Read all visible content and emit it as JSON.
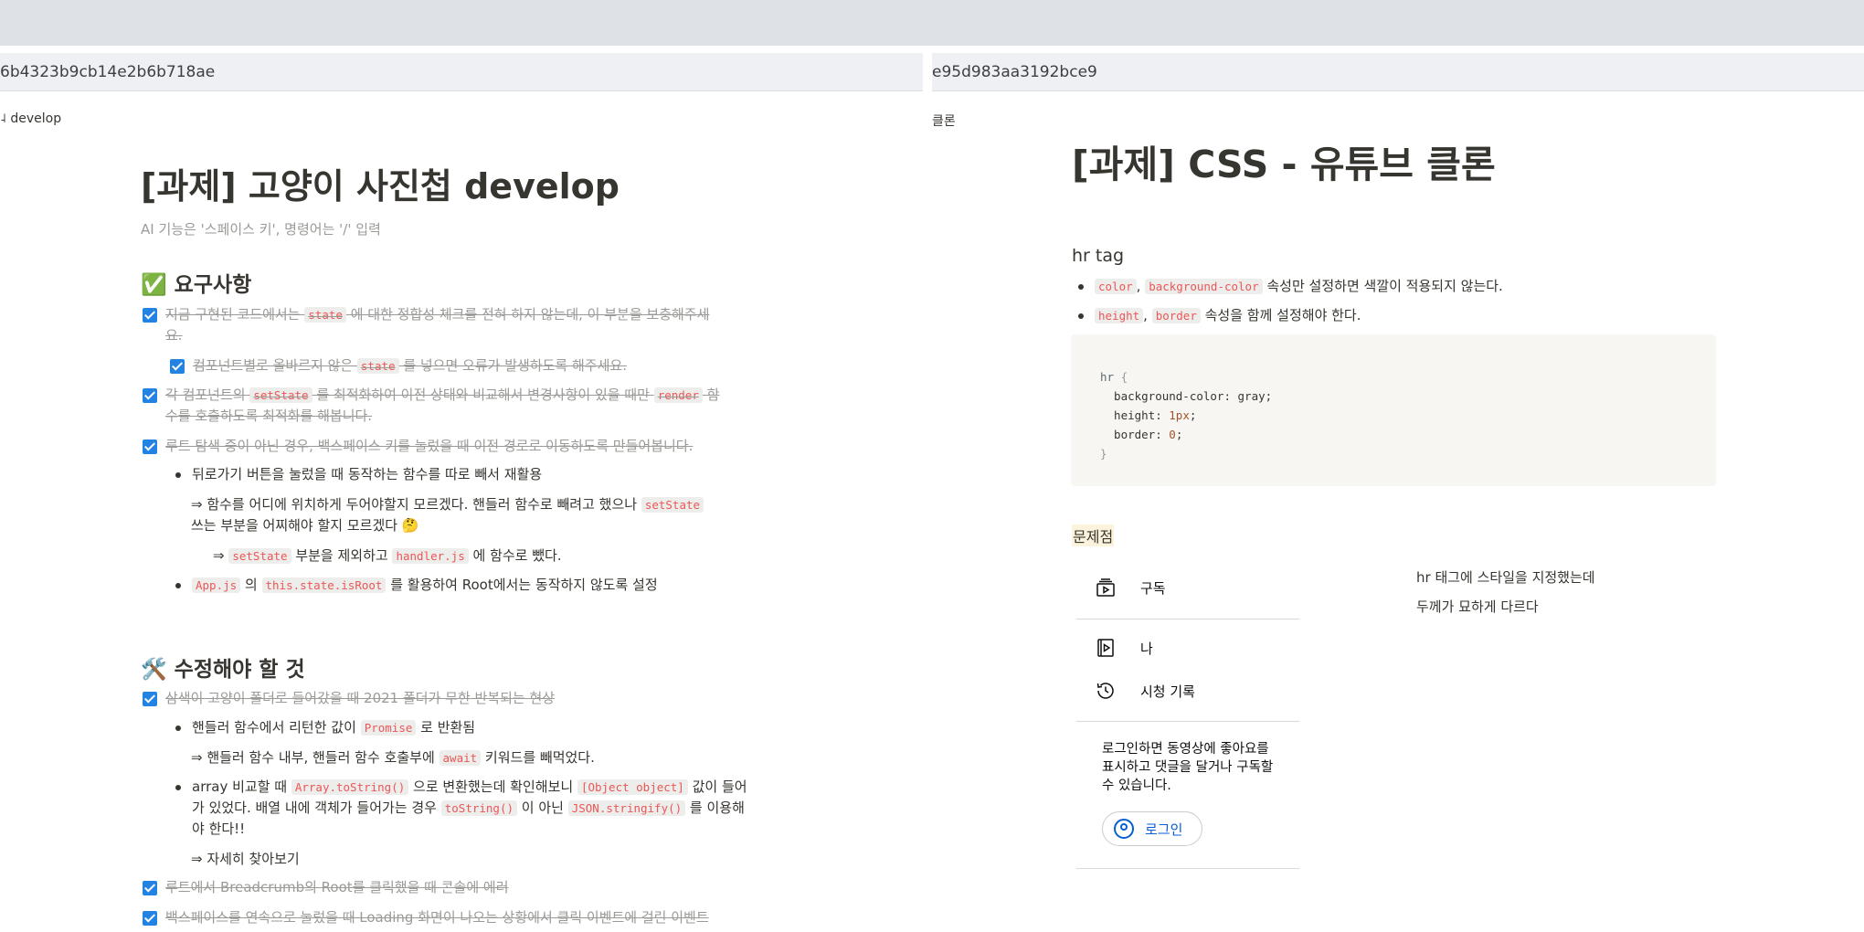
{
  "browser": {
    "left_url": "6b4323b9cb14e2b6b718ae",
    "right_url": "e95d983aa3192bce9",
    "left_breadcrumb": "˨ develop",
    "right_breadcrumb": "클론"
  },
  "left_page": {
    "title": "[과제] 고양이 사진첩 develop",
    "ai_placeholder": "AI 기능은 '스페이스 키', 명령어는 '/' 입력",
    "section1": {
      "emoji": "✅",
      "heading": "요구사항"
    },
    "todos": [
      {
        "t1": "지금 구현된 코드에서는 ",
        "c1": "state",
        "t2": " 에 대한 정합성 체크를 전혀 하지 않는데, 이 부분을 보충해주세",
        "t3": "요."
      },
      {
        "t1": "컴포넌트별로 올바르지 않은 ",
        "c1": "state",
        "t2": " 를 넣으면 오류가 발생하도록 해주세요."
      },
      {
        "t1": "각 컴포넌트의 ",
        "c1": "setState",
        "t2": " 를 최적화하여 이전 상태와 비교해서 변경사항이 있을 때만 ",
        "c2": "render",
        "t3": " 함",
        "t4": "수를 호출하도록 최적화를 해봅니다."
      },
      {
        "t1": "루트 탐색 중이 아닌 경우, 백스페이스 키를 눌렀을 때 이전 경로로 이동하도록 만들어봅니다."
      }
    ],
    "bullet1": "뒤로가기 버튼을 눌렀을 때 동작하는 함수를 따로 빼서 재활용",
    "arrow1_line1": "⇒ 함수를 어디에 위치하게 두어야할지 모르겠다. 핸들러 함수로 빼려고 했으나 ",
    "arrow1_code": "setState",
    "arrow1_line2": "쓰는 부분을 어찌해야 할지 모르겠다 🤔",
    "arrow2_a": "⇒ ",
    "arrow2_code1": "setState",
    "arrow2_b": " 부분을 제외하고 ",
    "arrow2_code2": "handler.js",
    "arrow2_c": " 에 함수로 뺐다.",
    "bullet2_code1": "App.js",
    "bullet2_a": " 의 ",
    "bullet2_code2": "this.state.isRoot",
    "bullet2_b": " 를 활용하여 Root에서는 동작하지 않도록 설정",
    "section2": {
      "emoji": "🛠️",
      "heading": "수정해야 할 것"
    },
    "fix1": "삼색이 고양이 폴더로 들어갔을 때 2021 폴더가 무한 반복되는 현상",
    "fix1_b1_a": "핸들러 함수에서 리턴한 값이 ",
    "fix1_b1_code": "Promise",
    "fix1_b1_b": " 로 반환됨",
    "fix1_arrow_a": "⇒ 핸들러 함수 내부, 핸들러 함수 호출부에 ",
    "fix1_arrow_code": "await",
    "fix1_arrow_b": " 키워드를 빼먹었다.",
    "fix1_b2_a": "array 비교할 때 ",
    "fix1_b2_code1": "Array.toString()",
    "fix1_b2_b": " 으로 변환했는데 확인해보니 ",
    "fix1_b2_code2": "[Object object]",
    "fix1_b2_c": " 값이 들어",
    "fix1_b2_d": "가 있었다. 배열 내에 객체가 들어가는 경우 ",
    "fix1_b2_code3": "toString()",
    "fix1_b2_e": " 이 아닌 ",
    "fix1_b2_code4": "JSON.stringify()",
    "fix1_b2_f": " 를 이용해",
    "fix1_b2_g": "야 한다!!",
    "fix1_more": "⇒ 자세히 찾아보기",
    "fix2": "루트에서 Breadcrumb의 Root를 클릭했을 때 콘솔에 에러",
    "fix3": "백스페이스를 연속으로 눌렀을 때 Loading 화면이 나오는 상황에서 클릭 이벤트에 걸린 이벤트"
  },
  "right_page": {
    "title": "[과제] CSS - 유튜브 클론",
    "hr_heading": "hr tag",
    "b1_code1": "color",
    "b1_comma": ", ",
    "b1_code2": "background-color",
    "b1_text": " 속성만 설정하면 색깔이 적용되지 않는다.",
    "b2_code1": "height",
    "b2_comma": ", ",
    "b2_code2": "border",
    "b2_text": " 속성을 함께 설정해야 한다.",
    "code": {
      "l1_sel": "hr",
      "l1_brace": " {",
      "l2_prop": "  background-color",
      "l2_val": ": gray;",
      "l3_prop": "  height",
      "l3_colon": ": ",
      "l3_val": "1px",
      "l3_end": ";",
      "l4_prop": "  border",
      "l4_colon": ": ",
      "l4_val": "0",
      "l4_end": ";",
      "l5": "}"
    },
    "problem_label": "문제점",
    "yt": {
      "subscribe": "구독",
      "me": "나",
      "history": "시청 기록",
      "login_msg": "로그인하면 동영상에 좋아요를 표시하고 댓글을 달거나 구독할 수 있습니다.",
      "login_btn": "로그인"
    },
    "note_line1": "hr 태그에 스타일을 지정했는데",
    "note_line2": "두께가 묘하게 다르다"
  }
}
